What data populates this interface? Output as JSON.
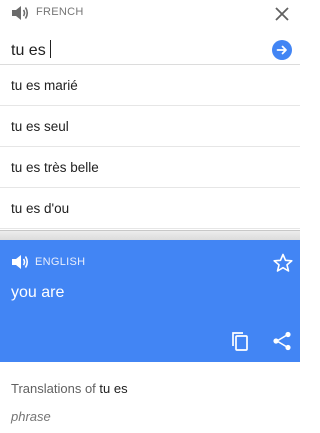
{
  "source": {
    "language": "FRENCH",
    "input_value": "tu es",
    "speaker_icon": "volume-icon",
    "close_icon": "close-icon",
    "go_icon": "arrow-right-circle-icon"
  },
  "suggestions": [
    "tu es marié",
    "tu es seul",
    "tu es très belle",
    "tu es d'ou"
  ],
  "target": {
    "language": "ENGLISH",
    "translation": "you are",
    "background_color": "#4285f4",
    "icons": [
      "volume-icon",
      "star-icon",
      "copy-icon",
      "share-icon"
    ]
  },
  "translations_section": {
    "prefix": "Translations of",
    "term": "tu es",
    "part_of_speech": "phrase"
  }
}
